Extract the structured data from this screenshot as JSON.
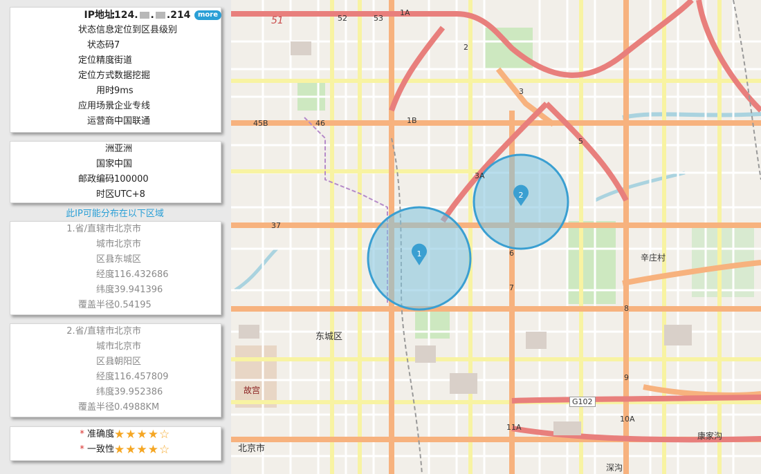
{
  "ip_info": {
    "ip_label": "IP地址",
    "ip_prefix": "124.",
    "ip_suffix": "214",
    "more_label": "more",
    "rows": [
      {
        "key": "状态信息",
        "value": "定位到区县级别"
      },
      {
        "key": "状态码",
        "value": "7"
      },
      {
        "key": "定位精度",
        "value": "街道"
      },
      {
        "key": "定位方式",
        "value": "数据挖掘"
      },
      {
        "key": "用时",
        "value": "9ms"
      },
      {
        "key": "应用场景",
        "value": "企业专线"
      },
      {
        "key": "运营商",
        "value": "中国联通"
      }
    ]
  },
  "geo": {
    "rows": [
      {
        "key": "洲",
        "value": "亚洲"
      },
      {
        "key": "国家",
        "value": "中国"
      },
      {
        "key": "邮政编码",
        "value": "100000"
      },
      {
        "key": "时区",
        "value": "UTC+8"
      }
    ]
  },
  "distribution_title": "此IP可能分布在以下区域",
  "regions": [
    {
      "rows": [
        {
          "key": "1.省/直辖市",
          "value": "北京市"
        },
        {
          "key": "城市",
          "value": "北京市"
        },
        {
          "key": "区县",
          "value": "东城区"
        },
        {
          "key": "经度",
          "value": "116.432686"
        },
        {
          "key": "纬度",
          "value": "39.941396"
        },
        {
          "key": "覆盖半径",
          "value": "0.54195"
        }
      ]
    },
    {
      "rows": [
        {
          "key": "2.省/直辖市",
          "value": "北京市"
        },
        {
          "key": "城市",
          "value": "北京市"
        },
        {
          "key": "区县",
          "value": "朝阳区"
        },
        {
          "key": "经度",
          "value": "116.457809"
        },
        {
          "key": "纬度",
          "value": "39.952386"
        },
        {
          "key": "覆盖半径",
          "value": "0.4988KM"
        }
      ]
    }
  ],
  "ratings": {
    "required_mark": "*",
    "accuracy_label": "准确度",
    "accuracy_stars": "★★★★☆",
    "accuracy_value": 4,
    "consistency_label": "一致性",
    "consistency_stars": "★★★★☆",
    "consistency_value": 4
  },
  "map": {
    "markers": [
      {
        "label": "1"
      },
      {
        "label": "2"
      }
    ],
    "place_labels": {
      "dongcheng": "东城区",
      "beijing": "北京市",
      "gugong": "故宫",
      "xinzhuang": "辛庄村",
      "kangjiagou": "康家沟",
      "shenlu": "深沟",
      "road_g102": "G102",
      "road_51": "51",
      "road_37": "37",
      "road_45b": "45B",
      "road_46": "46",
      "road_1b": "1B",
      "road_3a": "3A",
      "road_11a": "11A",
      "road_10a": "10A",
      "road_2": "2",
      "road_3": "3",
      "road_5": "5",
      "road_6": "6",
      "road_7": "7",
      "road_8": "8",
      "road_9": "9",
      "road_1a": "1A",
      "road_52": "52",
      "road_53": "53"
    },
    "colors": {
      "circle_fill": "#7fc3df",
      "circle_stroke": "#3a9fd1",
      "marker": "#3a9fd1",
      "major_road": "#f7b27e",
      "highway": "#e87f7c",
      "yellow_road": "#f8f3a2"
    }
  }
}
